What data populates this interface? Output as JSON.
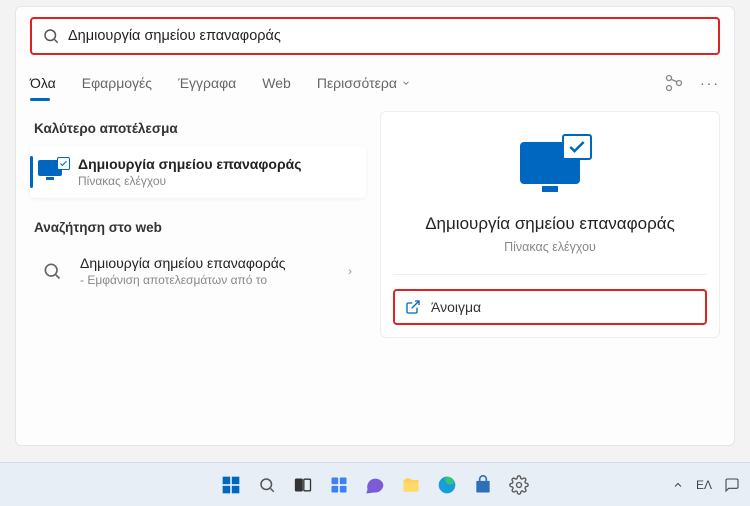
{
  "search": {
    "value": "Δημιουργία σημείου επαναφοράς"
  },
  "tabs": {
    "all": "Όλα",
    "apps": "Εφαρμογές",
    "docs": "Έγγραφα",
    "web": "Web",
    "more": "Περισσότερα"
  },
  "left": {
    "best_match_h": "Καλύτερο αποτέλεσμα",
    "best_match": {
      "title": "Δημιουργία σημείου επαναφοράς",
      "subtitle": "Πίνακας ελέγχου"
    },
    "web_h": "Αναζήτηση στο web",
    "web": {
      "title": "Δημιουργία σημείου επαναφοράς",
      "subtitle": "- Εμφάνιση αποτελεσμάτων από το"
    }
  },
  "right": {
    "title": "Δημιουργία σημείου επαναφοράς",
    "subtitle": "Πίνακας ελέγχου",
    "open": "Άνοιγμα"
  },
  "tray": {
    "lang": "ΕΛ"
  }
}
